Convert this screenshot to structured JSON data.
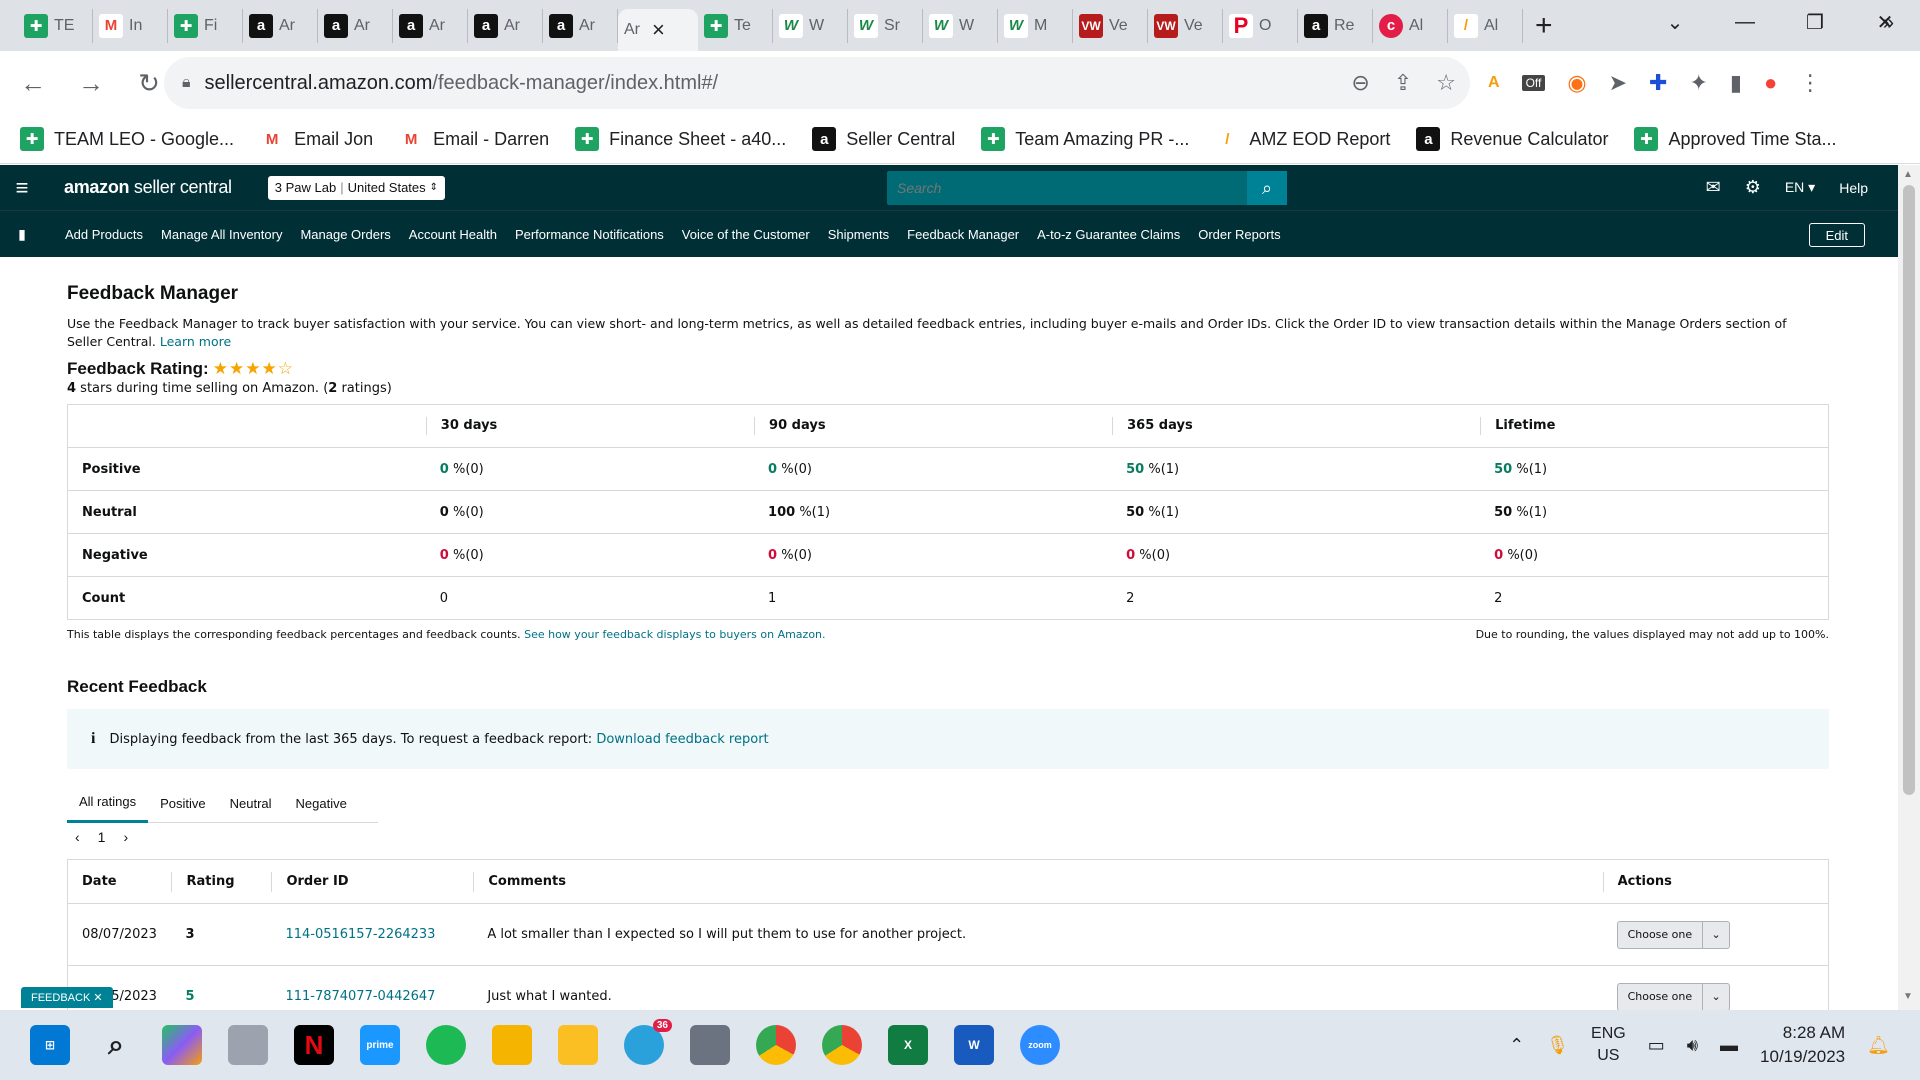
{
  "tabs": [
    {
      "label": "TE",
      "fav": "g"
    },
    {
      "label": "In",
      "fav": "m"
    },
    {
      "label": "Fi",
      "fav": "g"
    },
    {
      "label": "Ar",
      "fav": "a"
    },
    {
      "label": "Ar",
      "fav": "a"
    },
    {
      "label": "Ar",
      "fav": "a"
    },
    {
      "label": "Ar",
      "fav": "a"
    },
    {
      "label": "Ar",
      "fav": "a"
    },
    {
      "label": "Ar",
      "fav": "active"
    },
    {
      "label": "Te",
      "fav": "g"
    },
    {
      "label": "W",
      "fav": "w"
    },
    {
      "label": "Sr",
      "fav": "w"
    },
    {
      "label": "W",
      "fav": "w"
    },
    {
      "label": "M",
      "fav": "w"
    },
    {
      "label": "Ve",
      "fav": "vw"
    },
    {
      "label": "Ve",
      "fav": "vw"
    },
    {
      "label": "O",
      "fav": "p"
    },
    {
      "label": "Re",
      "fav": "a"
    },
    {
      "label": "Al",
      "fav": "c"
    },
    {
      "label": "Al",
      "fav": "z"
    }
  ],
  "browser": {
    "url_host": "sellercentral.amazon.com",
    "url_path": "/feedback-manager/index.html#/",
    "new_tab": "+",
    "ext_off": "Off"
  },
  "bookmarks": [
    {
      "label": "TEAM LEO - Google...",
      "fav": "g"
    },
    {
      "label": "Email Jon",
      "fav": "m"
    },
    {
      "label": "Email - Darren",
      "fav": "m"
    },
    {
      "label": "Finance Sheet - a40...",
      "fav": "g"
    },
    {
      "label": "Seller Central",
      "fav": "a"
    },
    {
      "label": "Team Amazing PR -...",
      "fav": "g"
    },
    {
      "label": "AMZ EOD Report",
      "fav": "z"
    },
    {
      "label": "Revenue Calculator",
      "fav": "a"
    },
    {
      "label": "Approved Time Sta...",
      "fav": "g"
    }
  ],
  "header": {
    "logo_bold": "amazon",
    "logo_rest": " seller central",
    "store": "3 Paw Lab",
    "marketplace": "United States",
    "search_placeholder": "Search",
    "lang": "EN",
    "help": "Help"
  },
  "nav": {
    "links": [
      "Add Products",
      "Manage All Inventory",
      "Manage Orders",
      "Account Health",
      "Performance Notifications",
      "Voice of the Customer",
      "Shipments",
      "Feedback Manager",
      "A-to-z Guarantee Claims",
      "Order Reports"
    ],
    "edit": "Edit"
  },
  "main": {
    "title": "Feedback Manager",
    "intro": "Use the Feedback Manager to track buyer satisfaction with your service. You can view short- and long-term metrics, as well as detailed feedback entries, including buyer e-mails and Order IDs. Click the Order ID to view transaction details within the Manage Orders section of Seller Central.",
    "learn_more": "Learn more",
    "rating_label": "Feedback Rating:",
    "rating_stars": 4,
    "rating_desc_stars": "4",
    "rating_desc_mid": " stars during time selling on Amazon. (",
    "rating_desc_count": "2",
    "rating_desc_end": " ratings)",
    "metric_headers": [
      "30 days",
      "90 days",
      "365 days",
      "Lifetime"
    ],
    "metric_rows": [
      {
        "label": "Positive",
        "cells": [
          {
            "n": "0",
            "r": " %(0)",
            "c": "pos"
          },
          {
            "n": "0",
            "r": " %(0)",
            "c": "pos"
          },
          {
            "n": "50",
            "r": " %(1)",
            "c": "pos"
          },
          {
            "n": "50",
            "r": " %(1)",
            "c": "pos"
          }
        ]
      },
      {
        "label": "Neutral",
        "cells": [
          {
            "n": "0",
            "r": " %(0)",
            "c": "plain"
          },
          {
            "n": "100",
            "r": " %(1)",
            "c": "plain"
          },
          {
            "n": "50",
            "r": " %(1)",
            "c": "plain"
          },
          {
            "n": "50",
            "r": " %(1)",
            "c": "plain"
          }
        ]
      },
      {
        "label": "Negative",
        "cells": [
          {
            "n": "0",
            "r": " %(0)",
            "c": "neg"
          },
          {
            "n": "0",
            "r": " %(0)",
            "c": "neg"
          },
          {
            "n": "0",
            "r": " %(0)",
            "c": "neg"
          },
          {
            "n": "0",
            "r": " %(0)",
            "c": "neg"
          }
        ]
      },
      {
        "label": "Count",
        "cells": [
          {
            "n": "",
            "r": "0",
            "c": ""
          },
          {
            "n": "",
            "r": "1",
            "c": ""
          },
          {
            "n": "",
            "r": "2",
            "c": ""
          },
          {
            "n": "",
            "r": "2",
            "c": ""
          }
        ]
      }
    ],
    "table_note": "This table displays the corresponding feedback percentages and feedback counts.",
    "table_note_link": "See how your feedback displays to buyers on Amazon.",
    "rounding_note": "Due to rounding, the values displayed may not add up to 100%.",
    "recent_title": "Recent Feedback",
    "info_text": "Displaying feedback from the last 365 days. To request a feedback report:",
    "info_link": "Download feedback report",
    "filter_tabs": [
      "All ratings",
      "Positive",
      "Neutral",
      "Negative"
    ],
    "page_number": "1",
    "feedback_headers": [
      "Date",
      "Rating",
      "Order ID",
      "Comments",
      "Actions"
    ],
    "feedback_rows": [
      {
        "date": "08/07/2023",
        "rating": "3",
        "order": "114-0516157-2264233",
        "comment": "A lot smaller than I expected so I will put them to use for another project.",
        "action": "Choose one"
      },
      {
        "date": "07/15/2023",
        "rating": "5",
        "order": "111-7874077-0442647",
        "comment": "Just what I wanted.",
        "action": "Choose one"
      }
    ],
    "feedback_tab": "FEEDBACK"
  },
  "taskbar": {
    "telegram_badge": "36",
    "lang_top": "ENG",
    "lang_bottom": "US",
    "time": "8:28 AM",
    "date": "10/19/2023"
  }
}
